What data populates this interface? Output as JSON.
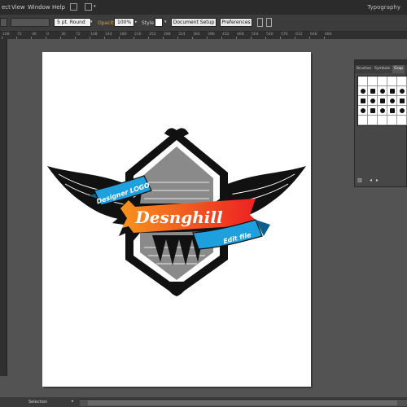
{
  "menubar": {
    "items": [
      "ect",
      "View",
      "Window",
      "Help"
    ],
    "workspace": "Typography"
  },
  "controlbar": {
    "stroke_value": "5 pt. Round",
    "opacity_label": "Opacity:",
    "opacity_value": "100%",
    "style_label": "Style:",
    "document_setup_label": "Document Setup",
    "preferences_label": "Preferences"
  },
  "ruler": {
    "ticks": [
      "108",
      "72",
      "36",
      "0",
      "36",
      "72",
      "108",
      "144",
      "180",
      "216",
      "252",
      "288",
      "324",
      "360",
      "396",
      "432",
      "468",
      "504",
      "540",
      "576",
      "612",
      "648",
      "684"
    ]
  },
  "artwork": {
    "banner_top": "Designer LOGO",
    "main_text": "Desnghill",
    "banner_bottom": "Edit file"
  },
  "panel": {
    "tabs": [
      "Brushes",
      "Symbols",
      "Grap"
    ],
    "active_tab": "Grap"
  },
  "statusbar": {
    "tool": "Selection"
  },
  "colors": {
    "orange": "#f7941d",
    "red": "#ed1c24",
    "ribbon_blue": "#1ea0de",
    "ribbon_dark": "#0b5f8c",
    "ui_dark": "#535353"
  }
}
